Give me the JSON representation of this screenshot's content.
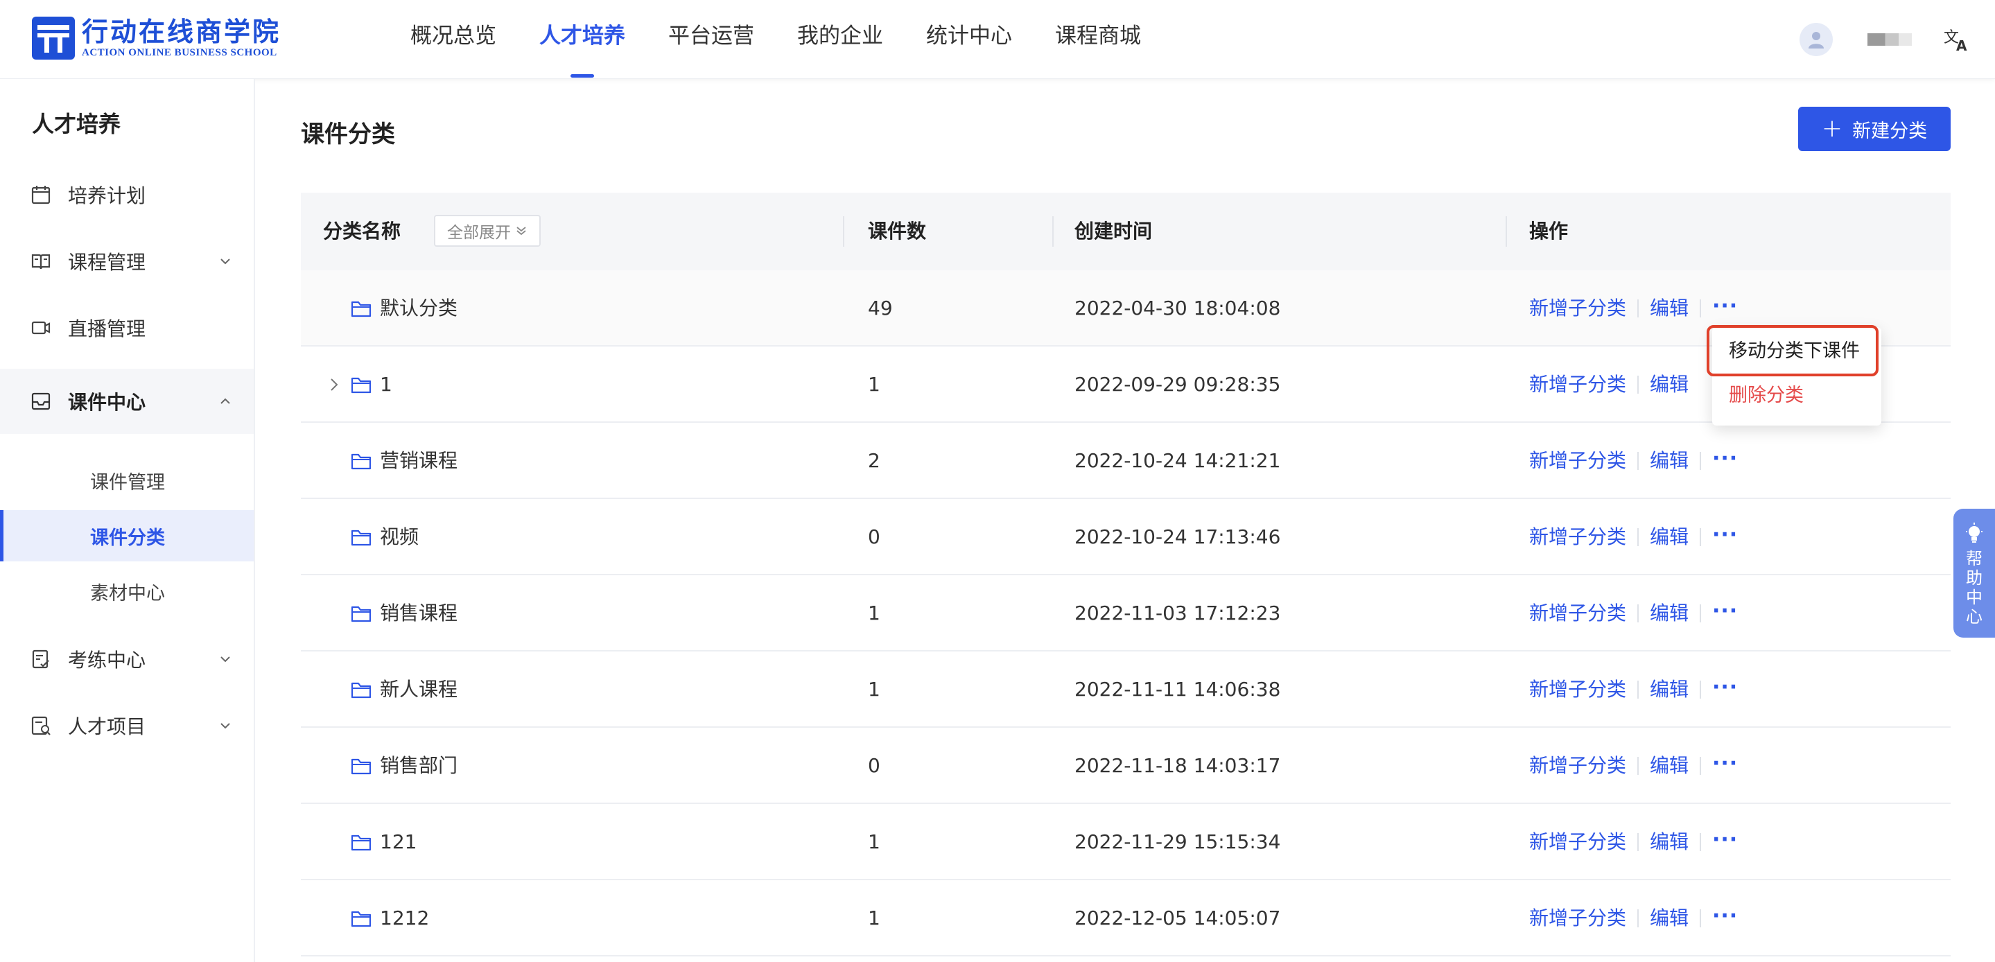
{
  "header": {
    "logo_cn": "行动在线商学院",
    "logo_en": "ACTION ONLINE BUSINESS SCHOOL",
    "nav": [
      {
        "label": "概况总览",
        "active": false
      },
      {
        "label": "人才培养",
        "active": true
      },
      {
        "label": "平台运营",
        "active": false
      },
      {
        "label": "我的企业",
        "active": false
      },
      {
        "label": "统计中心",
        "active": false
      },
      {
        "label": "课程商城",
        "active": false
      }
    ]
  },
  "sidebar": {
    "title": "人才培养",
    "items": [
      {
        "label": "培养计划",
        "icon": "calendar-icon"
      },
      {
        "label": "课程管理",
        "icon": "book-icon"
      },
      {
        "label": "直播管理",
        "icon": "video-camera-icon"
      },
      {
        "label": "课件中心",
        "icon": "inbox-icon"
      },
      {
        "label": "考练中心",
        "icon": "exam-icon"
      },
      {
        "label": "人才项目",
        "icon": "project-icon"
      }
    ],
    "sub_items": [
      "课件管理",
      "课件分类",
      "素材中心"
    ]
  },
  "main": {
    "title": "课件分类",
    "new_button": "新建分类",
    "table": {
      "headers": {
        "name": "分类名称",
        "expand_all": "全部展开",
        "count": "课件数",
        "created": "创建时间",
        "actions": "操作"
      },
      "action_labels": {
        "add_child": "新增子分类",
        "edit": "编辑",
        "more": "···"
      },
      "rows": [
        {
          "name": "默认分类",
          "count": "49",
          "created": "2022-04-30 18:04:08"
        },
        {
          "name": "1",
          "count": "1",
          "created": "2022-09-29 09:28:35"
        },
        {
          "name": "营销课程",
          "count": "2",
          "created": "2022-10-24 14:21:21"
        },
        {
          "name": "视频",
          "count": "0",
          "created": "2022-10-24 17:13:46"
        },
        {
          "name": "销售课程",
          "count": "1",
          "created": "2022-11-03 17:12:23"
        },
        {
          "name": "新人课程",
          "count": "1",
          "created": "2022-11-11 14:06:38"
        },
        {
          "name": "销售部门",
          "count": "0",
          "created": "2022-11-18 14:03:17"
        },
        {
          "name": "121",
          "count": "1",
          "created": "2022-11-29 15:15:34"
        },
        {
          "name": "1212",
          "count": "1",
          "created": "2022-12-05 14:05:07"
        }
      ]
    },
    "dropdown": {
      "move": "移动分类下课件",
      "delete": "删除分类"
    }
  },
  "help": {
    "label": "帮助中心"
  },
  "colors": {
    "accent": "#2e56e6",
    "danger": "#e54a4a",
    "highlight": "#e0402a"
  }
}
